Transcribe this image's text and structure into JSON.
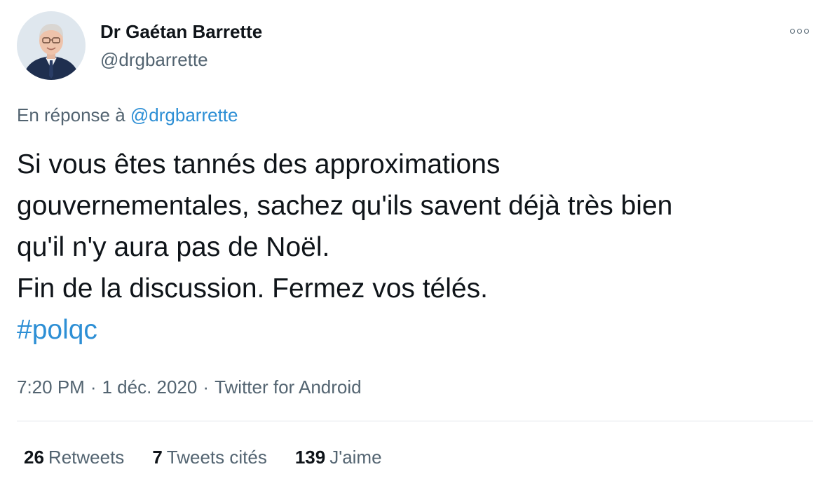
{
  "author": {
    "display_name": "Dr Gaétan Barrette",
    "handle": "@drgbarrette",
    "avatar_icon": "profile-photo"
  },
  "more_menu": {
    "icon": "more-horizontal-icon"
  },
  "reply_context": {
    "prefix": "En réponse à",
    "mention": "@drgbarrette"
  },
  "tweet": {
    "lines": [
      "Si vous êtes tannés des approximations",
      "gouvernementales, sachez qu'ils savent déjà très bien",
      "qu'il n'y aura pas de Noël.",
      "Fin de la discussion. Fermez vos télés."
    ],
    "hashtag": "#polqc"
  },
  "meta": {
    "time": "7:20 PM",
    "separator": "·",
    "date": "1 déc. 2020",
    "source": "Twitter for Android"
  },
  "stats": {
    "retweets_count": "26",
    "retweets_label": "Retweets",
    "quotes_count": "7",
    "quotes_label": "Tweets cités",
    "likes_count": "139",
    "likes_label": "J'aime"
  },
  "colors": {
    "link": "#2d8fd5",
    "secondary_text": "#536471",
    "primary_text": "#0f1419",
    "divider": "#e1e6ea"
  }
}
